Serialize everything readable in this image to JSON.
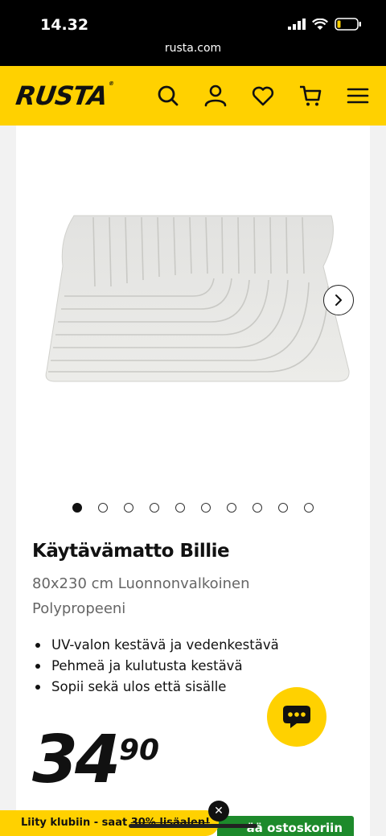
{
  "status": {
    "time": "14.32",
    "url": "rusta.com"
  },
  "header": {
    "logo": "RUSTA",
    "icons": [
      "search-icon",
      "account-icon",
      "heart-icon",
      "cart-icon",
      "menu-icon"
    ]
  },
  "product": {
    "title": "Käytävämatto Billie",
    "subtitle": "80x230 cm Luonnonvalkoinen Polypropeeni",
    "features": [
      "UV-valon kestävä ja vedenkestävä",
      "Pehmeä ja kulutusta kestävä",
      "Sopii sekä ulos että sisälle"
    ],
    "price_int": "34",
    "price_dec": "90",
    "gallery": {
      "total": 10,
      "active": 1
    }
  },
  "promo": {
    "text": "Liity klubiin - saat ",
    "strike": "30% lisäalen!",
    "close": "✕"
  },
  "cart_button": "ää ostoskoriin",
  "colors": {
    "brand": "#ffd100",
    "cta": "#1d8a2b"
  }
}
